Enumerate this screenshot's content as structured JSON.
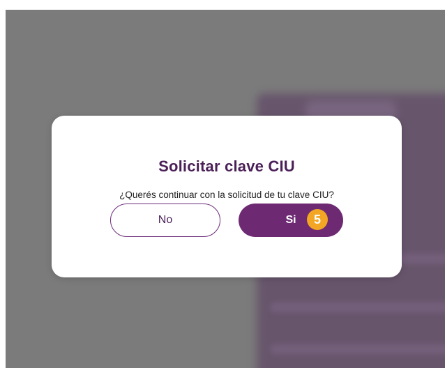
{
  "dialog": {
    "title": "Solicitar clave CIU",
    "message": "¿Querés continuar con la solicitud de tu clave CIU?",
    "no_label": "No",
    "yes_label": "Si",
    "step_badge": "5"
  },
  "colors": {
    "primary": "#6d2a73",
    "title": "#4b1f57",
    "badge": "#f2a623",
    "backdrop": "#7d7d7d"
  }
}
